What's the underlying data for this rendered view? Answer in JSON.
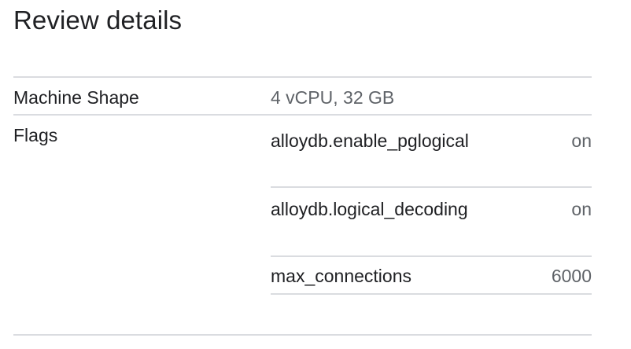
{
  "page": {
    "title": "Review details"
  },
  "details": {
    "machine_shape": {
      "label": "Machine Shape",
      "value": "4 vCPU, 32 GB"
    },
    "flags": {
      "label": "Flags",
      "items": [
        {
          "name": "alloydb.enable_pglogical",
          "value": "on"
        },
        {
          "name": "alloydb.logical_decoding",
          "value": "on"
        },
        {
          "name": "max_connections",
          "value": "6000"
        }
      ]
    }
  },
  "colors": {
    "text_primary": "#202124",
    "text_secondary": "#5f6368",
    "divider": "#dadce0"
  }
}
